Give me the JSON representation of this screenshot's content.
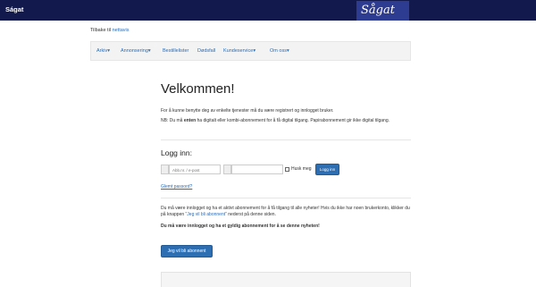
{
  "header": {
    "site_name": "Ságat",
    "logo_text": "Sågat"
  },
  "back": {
    "prefix": "Tilbake til",
    "link": "nettavis"
  },
  "nav": {
    "items": [
      "Arkiv",
      "Annonsering",
      "Bestillelister",
      "Dødsfall",
      "Kundeservice",
      "Om oss"
    ]
  },
  "main": {
    "title": "Velkommen!",
    "intro": "For å kunne benytte deg av enkelte tjenester må du være registrert og innlogget bruker.",
    "note_prefix": "NB: Du må",
    "note_bold": "enten",
    "note_rest": "ha digitalt eller kombi-abonnement for å få digital tilgang. Papirabonnement gir ikke digital tilgang."
  },
  "login": {
    "heading": "Logg inn:",
    "username_placeholder": "Abb.nr. / e-post",
    "password_value": "",
    "remember_label": "Husk meg",
    "submit_label": "Logg inn",
    "forgot_link": "Glemt passord?"
  },
  "info": {
    "line_1": "Du må være innlogget og ha et aktivt abonnement for å få tilgang til alle nyheter! Hvis du ikke har noen brukerkonto, klikker du på knappen",
    "line_1_link": "\"Jeg vil bli abonnent\"",
    "line_1_end": "nederst på denne siden.",
    "warning": "Du må være innlogget og ha et gyldig abonnement for å se denne nyheten!",
    "subscribe_button": "Jeg vil bli abonnent"
  }
}
